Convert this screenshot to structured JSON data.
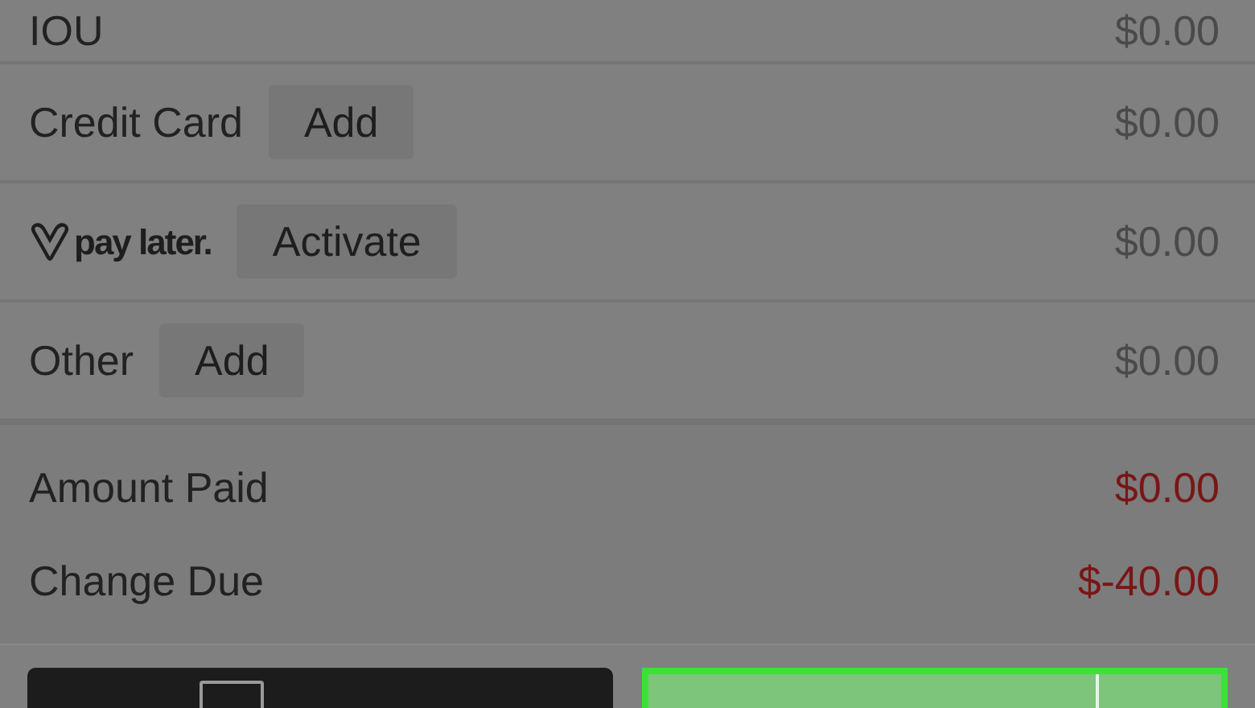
{
  "tenders": [
    {
      "kind": "text",
      "label": "IOU",
      "amount": "$0.00"
    },
    {
      "kind": "text",
      "label": "Credit Card",
      "action": "Add",
      "amount": "$0.00"
    },
    {
      "kind": "logo",
      "label": "pay later.",
      "action": "Activate",
      "amount": "$0.00"
    },
    {
      "kind": "text",
      "label": "Other",
      "action": "Add",
      "amount": "$0.00"
    }
  ],
  "summary": [
    {
      "label": "Amount Paid",
      "value": "$0.00"
    },
    {
      "label": "Change Due",
      "value": "$-40.00"
    }
  ]
}
